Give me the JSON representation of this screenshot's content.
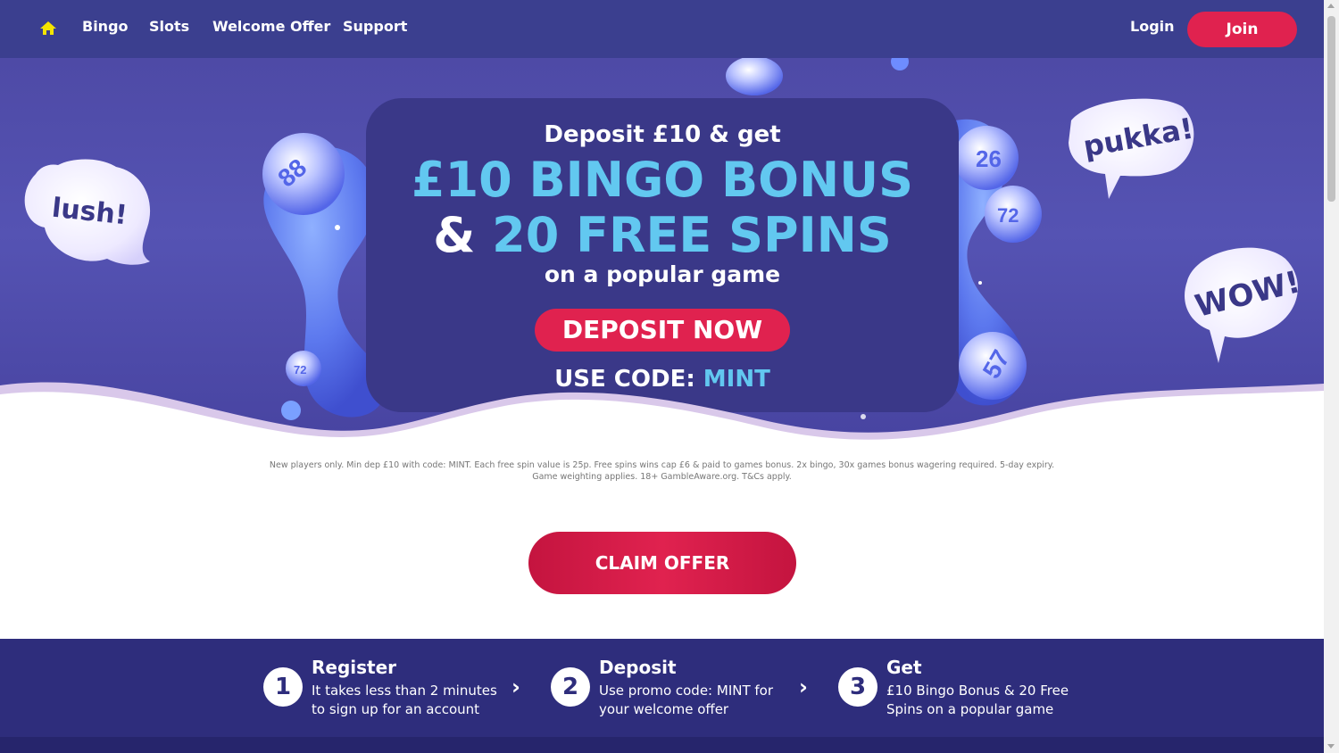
{
  "nav": {
    "home_icon": "home-icon",
    "links": [
      "Bingo",
      "Slots",
      "Welcome Offer",
      "Support"
    ],
    "login": "Login",
    "join": "Join",
    "home_icon_color": "#f5e400"
  },
  "hero": {
    "line1": "Deposit £10 & get",
    "big1": "£10 BINGO BONUS",
    "big2_amp": "&",
    "big2_rest": " 20 FREE SPINS",
    "sub": "on a popular game",
    "deposit_button": "DEPOSIT NOW",
    "code_label": "USE CODE:",
    "code_value": "MINT",
    "bubbles": [
      "lush!",
      "pukka!",
      "WOW!"
    ],
    "balls": [
      "88",
      "72",
      "26",
      "72",
      "57"
    ]
  },
  "terms": {
    "line1": "New players only. Min dep £10 with code: MINT. Each free spin value is 25p. Free spins wins cap £6 & paid to games bonus. 2x bingo, 30x games bonus wagering required. 5-day expiry.",
    "line2": "Game weighting applies. 18+ GambleAware.org. T&Cs apply."
  },
  "claim_button": "CLAIM OFFER",
  "steps": [
    {
      "num": "1",
      "title": "Register",
      "desc": "It takes less than 2 minutes to sign up for an account"
    },
    {
      "num": "2",
      "title": "Deposit",
      "desc": "Use promo code: MINT for your welcome offer"
    },
    {
      "num": "3",
      "title": "Get",
      "desc": "£10 Bingo Bonus & 20 Free Spins on a popular game"
    }
  ],
  "colors": {
    "nav_bg": "#3b3f8f",
    "accent_red": "#e0224f",
    "accent_cyan": "#62c8f0",
    "steps_bg": "#2e2d7c"
  }
}
